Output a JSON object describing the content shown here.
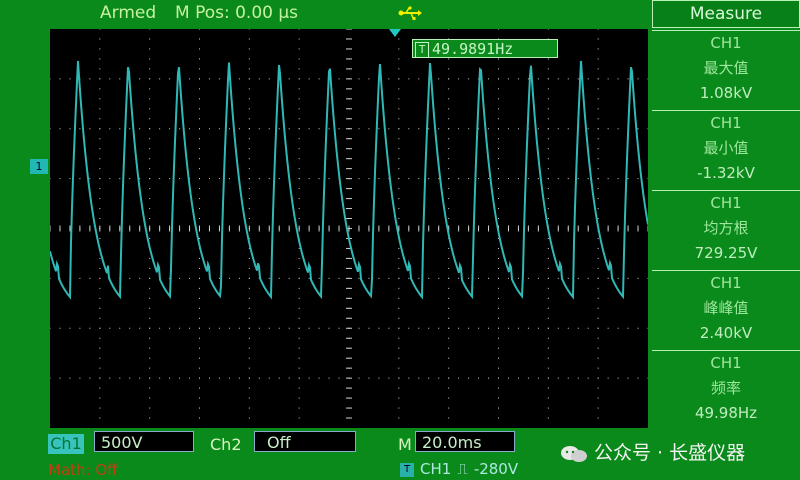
{
  "header": {
    "status": "Armed",
    "mpos": "M Pos: 0.00 µs",
    "usb_icon": "usb-icon"
  },
  "screen": {
    "frequency_readout": "49.9891Hz",
    "trigger_badge": "T",
    "channel_marker": "1"
  },
  "measure": {
    "title": "Measure",
    "items": [
      {
        "channel": "CH1",
        "name": "最大值",
        "value": "1.08kV"
      },
      {
        "channel": "CH1",
        "name": "最小值",
        "value": "-1.32kV"
      },
      {
        "channel": "CH1",
        "name": "均方根",
        "value": "729.25V"
      },
      {
        "channel": "CH1",
        "name": "峰峰值",
        "value": "2.40kV"
      },
      {
        "channel": "CH1",
        "name": "频率",
        "value": "49.98Hz"
      }
    ]
  },
  "bottom": {
    "ch1_label": "Ch1",
    "ch1_scale": "500V",
    "ch2_label": "Ch2",
    "ch2_value": "Off",
    "m_label": "M",
    "timebase": "20.0ms",
    "math_label": "Math: Off",
    "trigger_badge": "T",
    "trigger_source": "CH1",
    "trigger_edge": "⎍",
    "trigger_level": "-280V",
    "watermark": "公众号 · 长盛仪器"
  },
  "colors": {
    "background": "#0a8a1a",
    "screen": "#000000",
    "trace": "#2fb8b6",
    "grid": "#d0d0d0"
  }
}
